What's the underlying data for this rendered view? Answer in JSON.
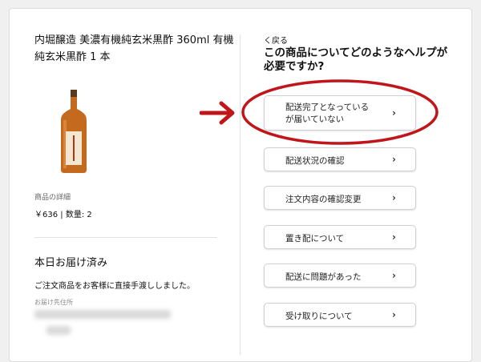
{
  "product": {
    "title": "内堀醸造 美濃有機純玄米黒酢 360ml 有機純玄米黒酢 1 本",
    "detail_label": "商品の詳細",
    "price_qty": "￥636 | 数量: 2"
  },
  "delivery": {
    "status": "本日お届け済み",
    "message": "ご注文商品をお客様に直接手渡ししました。",
    "address_label": "お届け先住所"
  },
  "help": {
    "back_label": "く戻る",
    "question": "この商品についてどのようなヘルプが必要ですか?",
    "options": [
      {
        "label": "配送完了となっている\nが届いていない"
      },
      {
        "label": "配送状況の確認"
      },
      {
        "label": "注文内容の確認変更"
      },
      {
        "label": "置き配について"
      },
      {
        "label": "配送に問題があった"
      },
      {
        "label": "受け取りについて"
      }
    ],
    "chevron": "›"
  },
  "colors": {
    "annotation": "#c0151b",
    "bottle": "#c46a1f"
  },
  "icons": [
    "chevron-right-icon",
    "arrow-right-icon",
    "bottle-image"
  ]
}
